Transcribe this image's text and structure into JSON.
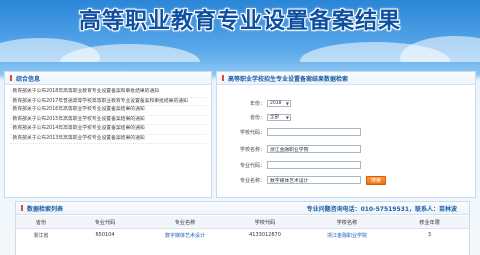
{
  "banner": {
    "title": "高等职业教育专业设置备案结果"
  },
  "news_panel": {
    "title": "综合信息",
    "items": [
      "教育部关于公布2018年高等职业教育专业设置备案和审批结果的通知",
      "教育部关于公布2017年普通高等学校高等职业教育专业设置备案和审批结果的通知",
      "教育部关于公布2016年高等职业学校专业设置备案结果的通知",
      "教育部关于公布2015年高等职业学校专业设置备案结果的通知",
      "教育部关于公布2014年高等职业学校专业设置备案结果的通知",
      "教育部关于公布2013年高等职业学校专业设置备案结果的通知"
    ]
  },
  "search_panel": {
    "title": "高等职业学校招生专业设置备案结果数据检索",
    "year_label": "年份：",
    "year_value": "2018",
    "province_label": "省份：",
    "province_value": "全部",
    "school_code_label": "学校代码：",
    "school_code_value": "",
    "school_name_label": "学校名称：",
    "school_name_value": "浙江金融职业学院",
    "major_code_label": "专业代码：",
    "major_code_value": "",
    "major_name_label": "专业名称：",
    "major_name_value": "数字媒体艺术设计",
    "search_button": "搜索"
  },
  "results_panel": {
    "title": "数据检索列表",
    "hotline": "专业问题咨询电话：010-57519531，联系人：苗林波",
    "columns": [
      "省份",
      "专业代码",
      "专业名称",
      "学校代码",
      "学校名称",
      "修业年限"
    ],
    "rows": [
      [
        "浙江省",
        "650104",
        "数字媒体艺术设计",
        "4133012870",
        "浙江金融职业学院",
        "3"
      ]
    ]
  }
}
